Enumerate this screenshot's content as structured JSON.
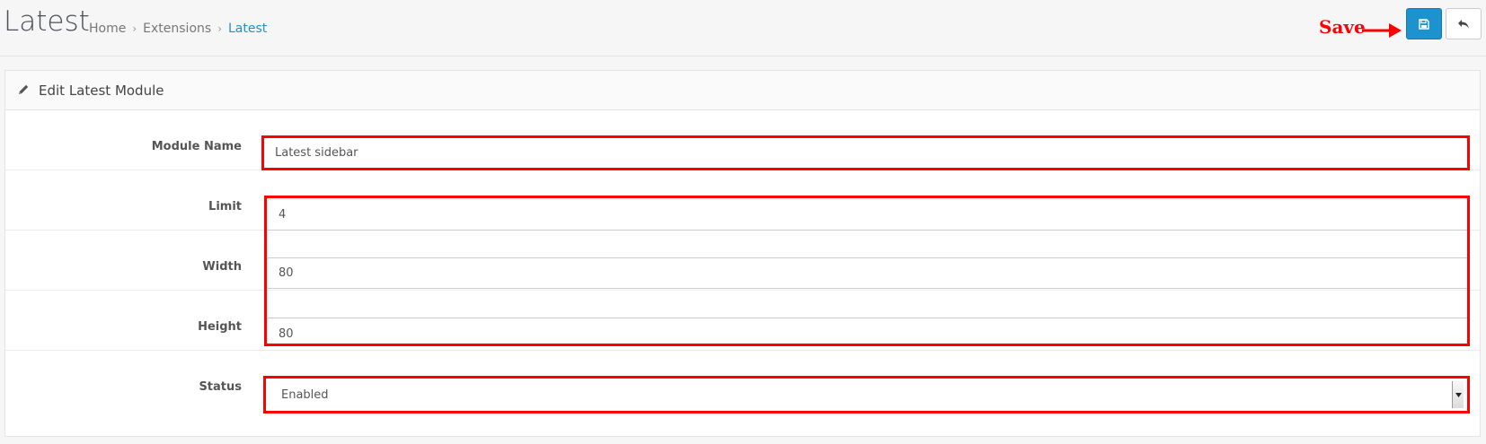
{
  "header": {
    "title": "Latest",
    "breadcrumb": [
      "Home",
      "Extensions",
      "Latest"
    ],
    "separator": "›",
    "save_annotation": "Save",
    "save_button_icon": "floppy-disk-icon",
    "back_button_icon": "reply-arrow-icon"
  },
  "panel": {
    "heading_icon": "pencil-icon",
    "heading": "Edit Latest Module"
  },
  "form": {
    "module_name": {
      "label": "Module Name",
      "value": "Latest sidebar"
    },
    "limit": {
      "label": "Limit",
      "value": "4"
    },
    "width": {
      "label": "Width",
      "value": "80"
    },
    "height": {
      "label": "Height",
      "value": "80"
    },
    "status": {
      "label": "Status",
      "value": "Enabled"
    }
  },
  "colors": {
    "accent": "#1e91cf",
    "annotation": "#ff0000"
  }
}
